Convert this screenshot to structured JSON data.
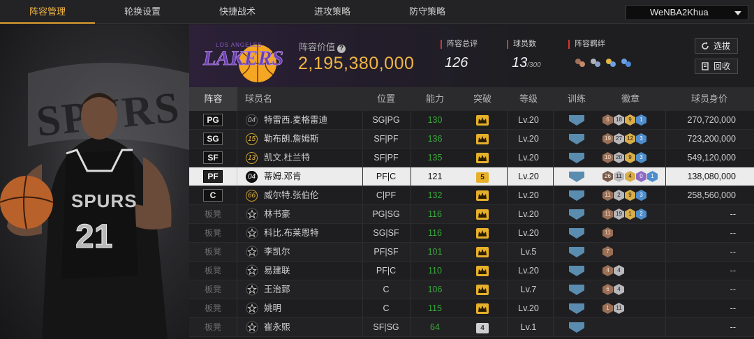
{
  "nav": {
    "tabs": [
      {
        "label": "阵容管理",
        "active": true
      },
      {
        "label": "轮换设置"
      },
      {
        "label": "快捷战术"
      },
      {
        "label": "进攻策略"
      },
      {
        "label": "防守策略"
      }
    ],
    "account": "WeNBA2Khua"
  },
  "portrait": {
    "team_logo_text": "SPURS",
    "jersey_text": "SPURS",
    "jersey_number": "21"
  },
  "header": {
    "team_logo_text": "LAKERS",
    "team_logo_subtext": "LOS ANGELES",
    "value_label": "阵容价值",
    "value": "2,195,380,000",
    "rating_label": "阵容总评",
    "rating": "126",
    "players_label": "球员数",
    "players_count": "13",
    "players_max": "/300",
    "chem_label": "阵容羁绊",
    "pick_button": "选拔",
    "recycle_button": "回收"
  },
  "table": {
    "headers": [
      "阵容",
      "球员名",
      "位置",
      "能力",
      "突破",
      "等级",
      "训练",
      "徽章",
      "球员身价"
    ],
    "rows": [
      {
        "slot": "PG",
        "starter": true,
        "num": "04",
        "gold": false,
        "name": "特雷西.麦格雷迪",
        "pos": "SG|PG",
        "ability": "130",
        "brk": "",
        "level": "Lv.20",
        "badges": [
          [
            "bronze",
            "6"
          ],
          [
            "silver",
            "18"
          ],
          [
            "gold",
            "9"
          ],
          [
            "blue",
            "1"
          ]
        ],
        "price": "270,720,000"
      },
      {
        "slot": "SG",
        "starter": true,
        "num": "15",
        "gold": true,
        "name": "勒布朗.詹姆斯",
        "pos": "SF|PF",
        "ability": "136",
        "brk": "",
        "level": "Lv.20",
        "badges": [
          [
            "bronze",
            "19"
          ],
          [
            "silver",
            "27"
          ],
          [
            "gold",
            "12"
          ],
          [
            "blue",
            "3"
          ]
        ],
        "price": "723,200,000"
      },
      {
        "slot": "SF",
        "starter": true,
        "num": "13",
        "gold": true,
        "name": "凯文.杜兰特",
        "pos": "SF|PF",
        "ability": "135",
        "brk": "",
        "level": "Lv.20",
        "badges": [
          [
            "bronze",
            "10"
          ],
          [
            "silver",
            "20"
          ],
          [
            "gold",
            "9"
          ],
          [
            "blue",
            "3"
          ]
        ],
        "price": "549,120,000"
      },
      {
        "slot": "PF",
        "starter": true,
        "num": "04",
        "gold": false,
        "name": "蒂姆.邓肯",
        "pos": "PF|C",
        "ability": "121",
        "brk": "5",
        "level": "Lv.20",
        "badges": [
          [
            "dark",
            "26"
          ],
          [
            "silver",
            "11"
          ],
          [
            "gold",
            "4"
          ],
          [
            "purple",
            "0"
          ],
          [
            "blue",
            "1"
          ]
        ],
        "price": "138,080,000"
      },
      {
        "slot": "C",
        "starter": true,
        "num": "66",
        "gold": true,
        "name": "威尔特.张伯伦",
        "pos": "C|PF",
        "ability": "132",
        "brk": "",
        "level": "Lv.20",
        "badges": [
          [
            "bronze",
            "11"
          ],
          [
            "silver",
            "2"
          ],
          [
            "gold",
            "9"
          ],
          [
            "blue",
            "3"
          ]
        ],
        "price": "258,560,000"
      },
      {
        "slot": "板凳",
        "starter": false,
        "name": "林书豪",
        "pos": "PG|SG",
        "ability": "116",
        "brk": "",
        "level": "Lv.20",
        "badges": [
          [
            "bronze",
            "11"
          ],
          [
            "silver",
            "19"
          ],
          [
            "gold",
            "1"
          ],
          [
            "blue",
            "2"
          ]
        ],
        "price": "--"
      },
      {
        "slot": "板凳",
        "starter": false,
        "name": "科比.布莱恩特",
        "pos": "SG|SF",
        "ability": "116",
        "brk": "",
        "level": "Lv.20",
        "badges": [
          [
            "bronze",
            "11"
          ]
        ],
        "price": "--"
      },
      {
        "slot": "板凳",
        "starter": false,
        "name": "李凯尔",
        "pos": "PF|SF",
        "ability": "101",
        "brk": "",
        "level": "Lv.5",
        "badges": [
          [
            "bronze",
            "7"
          ]
        ],
        "price": "--"
      },
      {
        "slot": "板凳",
        "starter": false,
        "name": "易建联",
        "pos": "PF|C",
        "ability": "110",
        "brk": "",
        "level": "Lv.20",
        "badges": [
          [
            "bronze",
            "4"
          ],
          [
            "silver",
            "4"
          ]
        ],
        "price": "--"
      },
      {
        "slot": "板凳",
        "starter": false,
        "name": "王治郅",
        "pos": "C",
        "ability": "106",
        "brk": "",
        "level": "Lv.7",
        "badges": [
          [
            "bronze",
            "6"
          ],
          [
            "silver",
            "4"
          ]
        ],
        "price": "--"
      },
      {
        "slot": "板凳",
        "starter": false,
        "name": "姚明",
        "pos": "C",
        "ability": "115",
        "brk": "",
        "level": "Lv.20",
        "badges": [
          [
            "bronze",
            "1"
          ],
          [
            "silver",
            "11"
          ]
        ],
        "price": "--"
      },
      {
        "slot": "板凳",
        "starter": false,
        "name": "崔永熙",
        "pos": "SF|SG",
        "ability": "64",
        "brk": "4",
        "brk_grey": true,
        "level": "Lv.1",
        "badges": [],
        "price": "--"
      }
    ]
  },
  "colors": {
    "accent": "#f0b545",
    "ability_green": "#37a83a",
    "stat_red": "#d33"
  }
}
